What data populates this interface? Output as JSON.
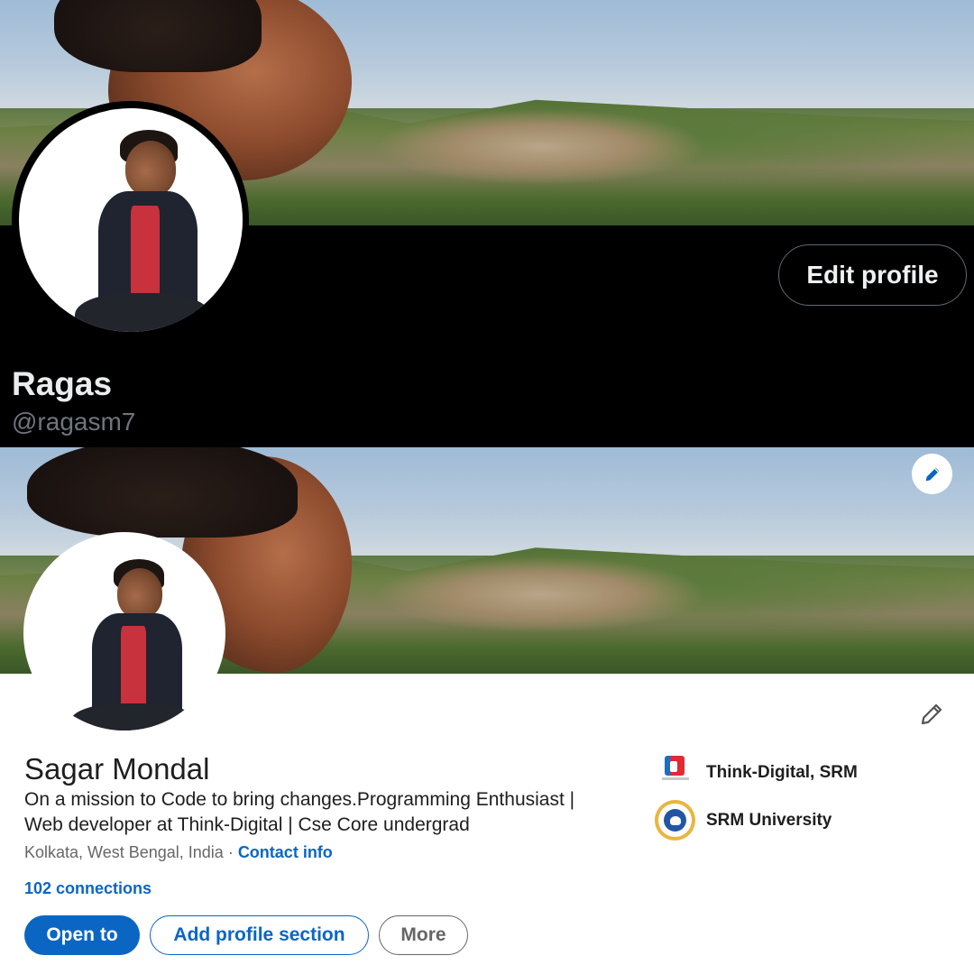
{
  "twitter": {
    "edit_profile_label": "Edit profile",
    "name": "Ragas",
    "handle": "@ragasm7"
  },
  "linkedin": {
    "name": "Sagar Mondal",
    "headline_line1": "On a mission to Code to bring changes.Programming Enthusiast |",
    "headline_line2": "Web developer at Think-Digital | Cse Core undergrad",
    "location": "Kolkata, West Bengal, India",
    "location_separator": " · ",
    "contact_info_label": "Contact info",
    "connections": "102 connections",
    "buttons": {
      "open_to": "Open to",
      "add_section": "Add profile section",
      "more": "More"
    },
    "organizations": [
      {
        "name": "Think-Digital, SRM",
        "icon": "think-digital-logo"
      },
      {
        "name": "SRM University",
        "icon": "srm-university-logo"
      }
    ]
  },
  "colors": {
    "linkedin_blue": "#0a66c2",
    "twitter_bg": "#000000",
    "twitter_text": "#e9edef",
    "twitter_muted": "#6e767d"
  },
  "icons": {
    "cover_edit": "pencil-icon",
    "intro_edit": "pencil-icon"
  }
}
